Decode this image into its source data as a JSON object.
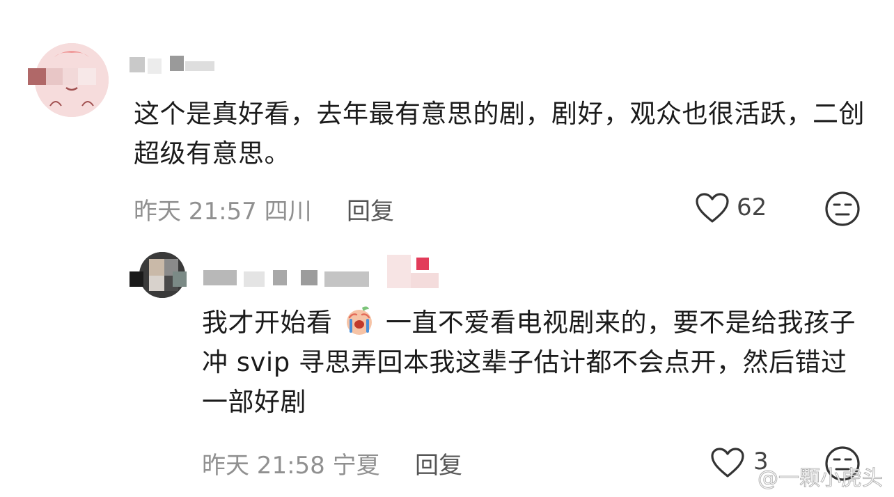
{
  "comments": [
    {
      "time": "昨天 21:57 四川",
      "reply_label": "回复",
      "text": "这个是真好看，去年最有意思的剧，剧好，观众也很活跃，二创超级有意思。",
      "likes": "62"
    },
    {
      "time": "昨天 21:58 宁夏",
      "reply_label": "回复",
      "text_before_emoji": "我才开始看",
      "text_after_emoji": "一直不爱看电视剧来的，要不是给我孩子冲 svip 寻思弄回本我这辈子估计都不会点开，然后错过一部好剧",
      "likes": "3"
    }
  ],
  "watermark": "@一颗小虎头",
  "icons": {
    "like": "heart-outline-icon",
    "reaction": "neutral-face-icon",
    "inline_emoji": "crying-peach-emoji"
  },
  "colors": {
    "text": "#1b1b1b",
    "meta": "#909090",
    "reply": "#555555"
  }
}
